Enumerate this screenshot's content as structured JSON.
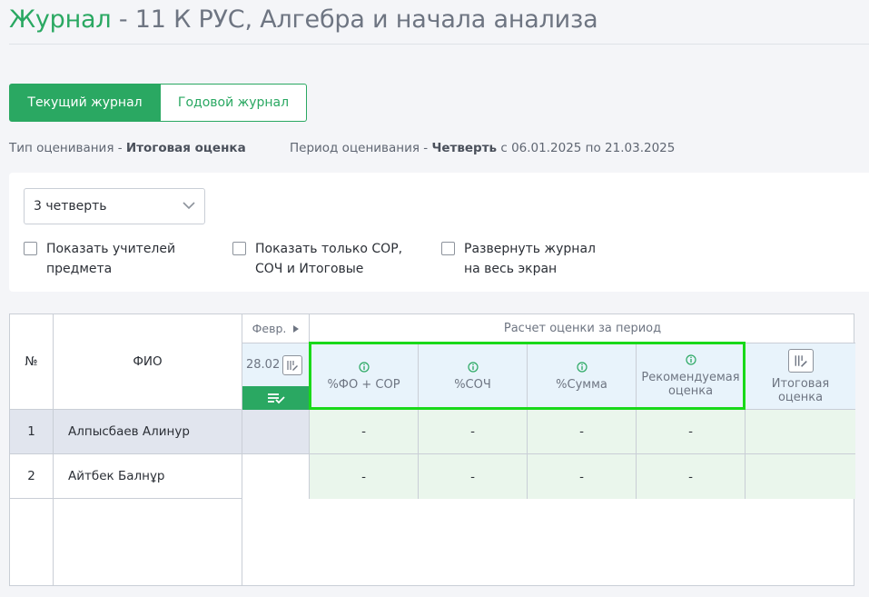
{
  "title": {
    "prefix": "Журнал",
    "rest": " - 11 К РУС, Алгебра и начала анализа"
  },
  "tabs": {
    "current": "Текущий журнал",
    "annual": "Годовой журнал"
  },
  "assessment": {
    "type_label": "Тип оценивания - ",
    "type_value": "Итоговая оценка"
  },
  "period": {
    "label": "Период оценивания - ",
    "value": "Четверть",
    "dates": " с 06.01.2025 по 21.03.2025"
  },
  "filters": {
    "quarter_select": "3 четверть",
    "checks": [
      {
        "line1": "Показать учителей",
        "line2": "предмета",
        "checked": false
      },
      {
        "line1": "Показать только СОР,",
        "line2": "СОЧ и Итоговые",
        "checked": false
      },
      {
        "line1": "Развернуть журнал",
        "line2": "на весь экран",
        "checked": false
      }
    ]
  },
  "table": {
    "col_num": "№",
    "col_name": "ФИО",
    "month": "Февр.",
    "date": "28.02",
    "period_calc": "Расчет оценки за период",
    "calc_cols": [
      {
        "l1": "%ФО + СОР",
        "l2": ""
      },
      {
        "l1": "%СОЧ",
        "l2": ""
      },
      {
        "l1": "%Сумма",
        "l2": ""
      },
      {
        "l1": "Рекомендуемая",
        "l2": "оценка"
      }
    ],
    "final_col": {
      "l1": "Итоговая",
      "l2": "оценка"
    },
    "rows": [
      {
        "num": "1",
        "name": "Алпысбаев Алинур",
        "values": [
          "-",
          "-",
          "-",
          "-"
        ]
      },
      {
        "num": "2",
        "name": "Айтбек Балнұр",
        "values": [
          "-",
          "-",
          "-",
          "-"
        ]
      }
    ]
  },
  "colors": {
    "accent": "#2aa862",
    "highlight": "#19d919"
  }
}
